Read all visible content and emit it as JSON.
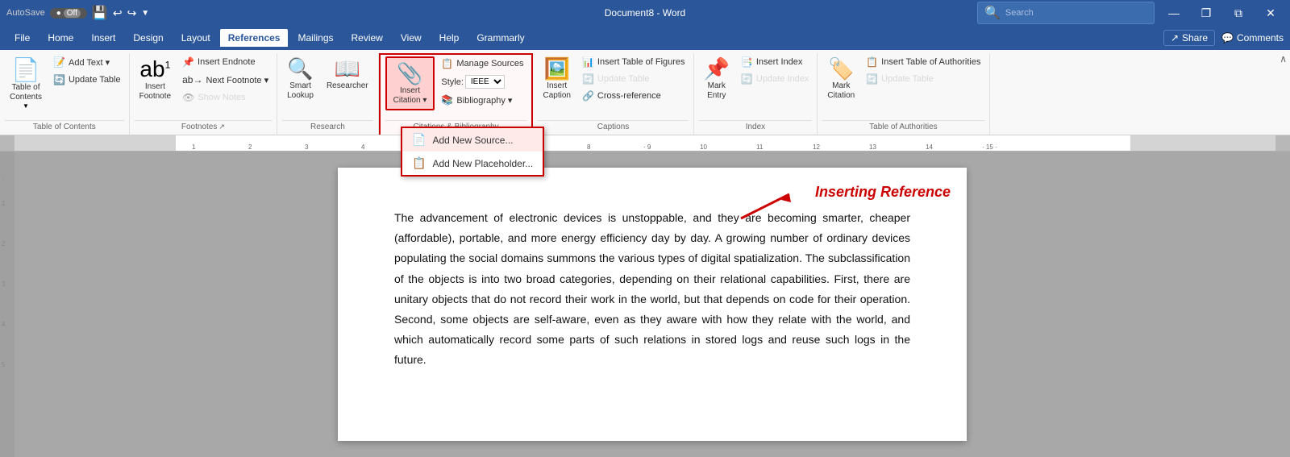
{
  "titlebar": {
    "autosave": "AutoSave",
    "autosave_state": "Off",
    "title": "Document8 - Word",
    "search_placeholder": "Search",
    "restore_btn": "❐",
    "minimize_btn": "—",
    "maximize_btn": "❐",
    "close_btn": "✕"
  },
  "menubar": {
    "items": [
      "File",
      "Home",
      "Insert",
      "Design",
      "Layout",
      "References",
      "Mailings",
      "Review",
      "View",
      "Help",
      "Grammarly"
    ],
    "active": "References",
    "share": "Share",
    "comments": "Comments"
  },
  "ribbon": {
    "groups": [
      {
        "name": "Table of Contents",
        "buttons": [
          {
            "label": "Table of\nContents",
            "icon": "📄"
          },
          {
            "label": "Add Text",
            "icon": "",
            "small": true
          },
          {
            "label": "Update Table",
            "icon": "",
            "small": true
          }
        ]
      },
      {
        "name": "Footnotes",
        "buttons": [
          {
            "label": "Insert\nFootnote",
            "icon": "📝"
          },
          {
            "label": "Insert Endnote",
            "small": true
          },
          {
            "label": "Next Footnote",
            "small": true
          },
          {
            "label": "Show Notes",
            "small": true,
            "disabled": true
          }
        ]
      },
      {
        "name": "Research",
        "buttons": [
          {
            "label": "Smart\nLookup",
            "icon": "🔍"
          },
          {
            "label": "Researcher",
            "icon": "📖"
          }
        ]
      },
      {
        "name": "Citations & Bibliography",
        "buttons": [
          {
            "label": "Insert\nCitation",
            "icon": "📎",
            "highlighted": true
          },
          {
            "label": "Manage Sources",
            "small": true
          },
          {
            "label": "Style: IEEE",
            "small": true,
            "style_select": true
          },
          {
            "label": "Bibliography",
            "small": true
          }
        ]
      },
      {
        "name": "Captions",
        "buttons": [
          {
            "label": "Insert\nCaption",
            "icon": "🖼️"
          },
          {
            "label": "Insert Table of Figures"
          },
          {
            "label": "Update Table",
            "disabled": true
          },
          {
            "label": "Cross-reference"
          }
        ]
      },
      {
        "name": "Index",
        "buttons": [
          {
            "label": "Mark\nEntry",
            "icon": "📌"
          },
          {
            "label": "Insert Index"
          },
          {
            "label": "Update Index",
            "disabled": true
          }
        ]
      },
      {
        "name": "Table of Authorities",
        "buttons": [
          {
            "label": "Mark\nCitation",
            "icon": "🏷️"
          },
          {
            "label": "Insert Table of Authorities"
          },
          {
            "label": "Update Table",
            "disabled": true
          }
        ]
      }
    ],
    "dropdown": {
      "items": [
        {
          "label": "Add New Source...",
          "icon": "📄",
          "highlighted": true
        },
        {
          "label": "Add New Placeholder...",
          "icon": "📋"
        }
      ]
    }
  },
  "document": {
    "annotation": "Inserting Reference",
    "text": "The advancement of electronic devices is unstoppable, and they are becoming smarter, cheaper (affordable), portable, and more energy efficiency day by day. A growing number of ordinary devices populating the social domains summons the various types of digital spatialization. The subclassification of the objects is into two broad categories, depending on their relational capabilities. First, there are unitary objects that do not record their work in the world, but that depends on code for their operation. Second, some objects are self-aware, even as they aware with how they relate with the world, and which automatically record some parts of such relations in stored logs and reuse such logs in the future."
  }
}
